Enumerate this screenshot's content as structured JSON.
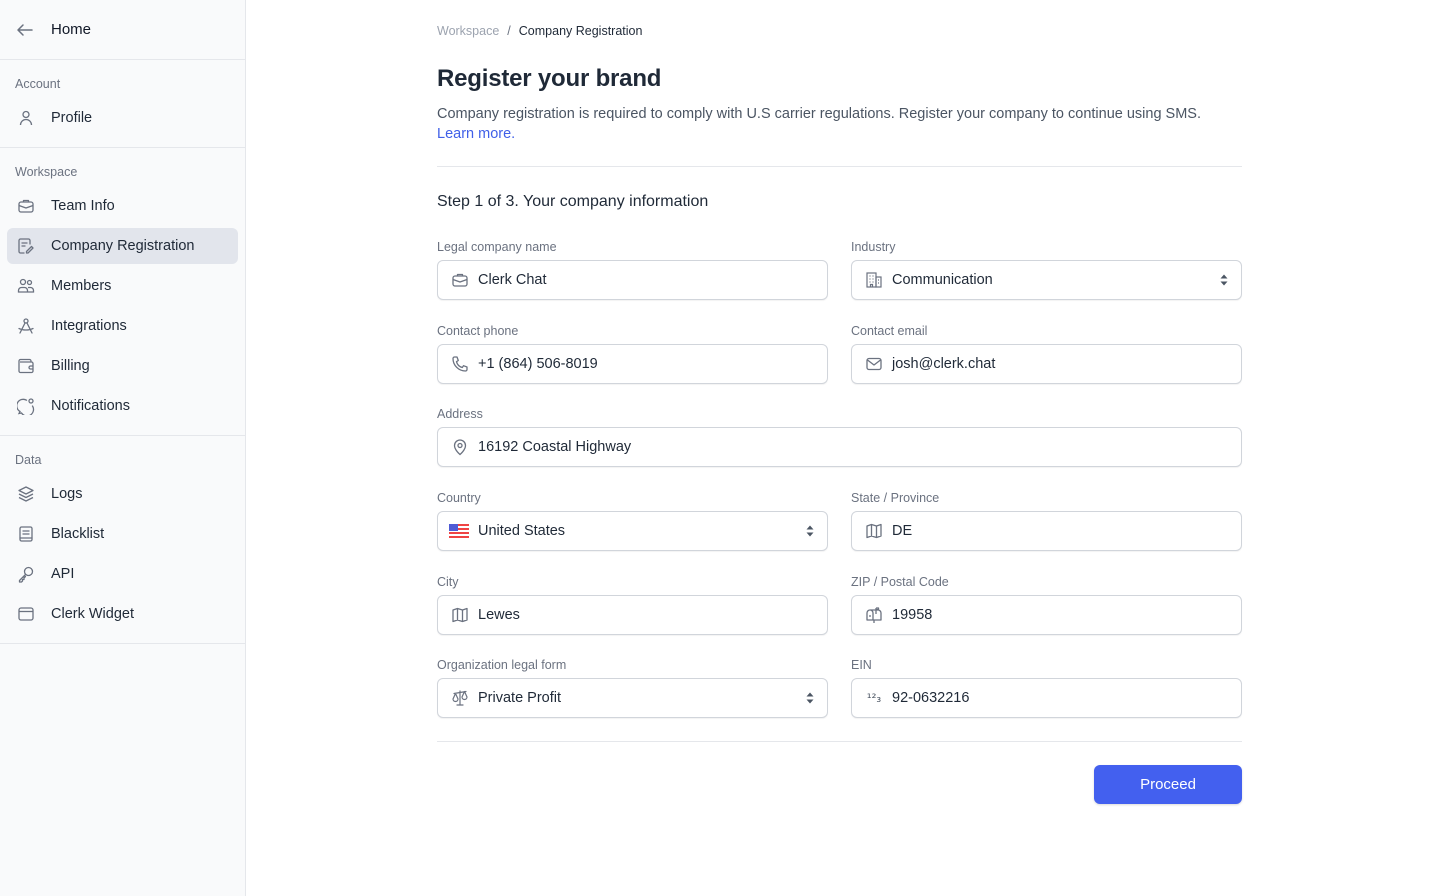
{
  "sidebar": {
    "home_label": "Home",
    "sections": [
      {
        "title": "Account",
        "items": [
          {
            "label": "Profile",
            "icon": "user-icon"
          }
        ]
      },
      {
        "title": "Workspace",
        "items": [
          {
            "label": "Team Info",
            "icon": "briefcase-icon"
          },
          {
            "label": "Company Registration",
            "icon": "document-edit-icon",
            "active": true
          },
          {
            "label": "Members",
            "icon": "users-icon"
          },
          {
            "label": "Integrations",
            "icon": "compass-tool-icon"
          },
          {
            "label": "Billing",
            "icon": "wallet-icon"
          },
          {
            "label": "Notifications",
            "icon": "chat-bubble-icon"
          }
        ]
      },
      {
        "title": "Data",
        "items": [
          {
            "label": "Logs",
            "icon": "layers-icon"
          },
          {
            "label": "Blacklist",
            "icon": "book-icon"
          },
          {
            "label": "API",
            "icon": "key-icon"
          },
          {
            "label": "Clerk Widget",
            "icon": "browser-window-icon"
          }
        ]
      }
    ]
  },
  "breadcrumb": {
    "parent": "Workspace",
    "separator": "/",
    "current": "Company Registration"
  },
  "page": {
    "title": "Register your brand",
    "description": "Company registration is required to comply with U.S carrier regulations. Register your company to continue using SMS.",
    "learn_more": "Learn more."
  },
  "form": {
    "step_title": "Step 1 of 3. Your company information",
    "fields": {
      "legal_name": {
        "label": "Legal company name",
        "value": "Clerk Chat",
        "icon": "briefcase-icon"
      },
      "industry": {
        "label": "Industry",
        "value": "Communication",
        "icon": "building-icon",
        "type": "select"
      },
      "phone": {
        "label": "Contact phone",
        "value": "+1 (864) 506-8019",
        "icon": "phone-icon"
      },
      "email": {
        "label": "Contact email",
        "value": "josh@clerk.chat",
        "icon": "envelope-icon"
      },
      "address": {
        "label": "Address",
        "value": "16192 Coastal Highway",
        "icon": "map-pin-icon"
      },
      "country": {
        "label": "Country",
        "value": "United States",
        "icon": "us-flag-icon",
        "type": "select"
      },
      "state": {
        "label": "State / Province",
        "value": "DE",
        "icon": "map-icon"
      },
      "city": {
        "label": "City",
        "value": "Lewes",
        "icon": "map-icon"
      },
      "zip": {
        "label": "ZIP / Postal Code",
        "value": "19958",
        "icon": "mailbox-icon"
      },
      "legal_form": {
        "label": "Organization legal form",
        "value": "Private Profit",
        "icon": "scale-icon",
        "type": "select"
      },
      "ein": {
        "label": "EIN",
        "value": "92-0632216",
        "icon": "numbers-icon",
        "icon_glyph": "¹²₃"
      }
    },
    "proceed_label": "Proceed"
  },
  "colors": {
    "accent": "#4360ef",
    "link": "#4060e8",
    "active_nav_bg": "#e2e5ec"
  }
}
